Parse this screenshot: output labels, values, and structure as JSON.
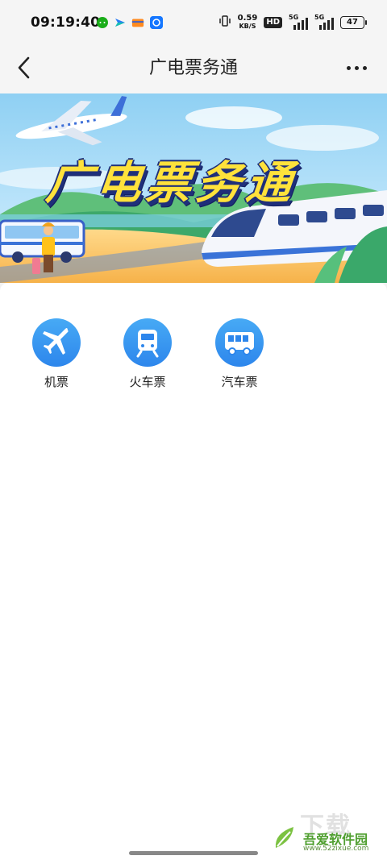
{
  "status_bar": {
    "time": "09:19:40",
    "net_speed_value": "0.59",
    "net_speed_unit": "KB/S",
    "hd_badge": "HD",
    "signal_1_label": "5G",
    "signal_2_label": "5G",
    "battery_level": "47",
    "notification_icons": [
      "wechat-icon",
      "feishu-icon",
      "card-icon",
      "alipay-icon"
    ]
  },
  "nav": {
    "title": "广电票务通"
  },
  "banner": {
    "title": "广电票务通"
  },
  "tickets": [
    {
      "label": "机票",
      "icon": "airplane-icon"
    },
    {
      "label": "火车票",
      "icon": "train-icon"
    },
    {
      "label": "汽车票",
      "icon": "bus-icon"
    }
  ],
  "colors": {
    "accent": "#2d86ec",
    "accent_light": "#47aaf5",
    "banner_title": "#ffe23b",
    "watermark_green": "#4f9f2f"
  },
  "watermark": {
    "big_text": "下载",
    "name": "吾爱软件园",
    "url": "www.52zixue.com"
  }
}
